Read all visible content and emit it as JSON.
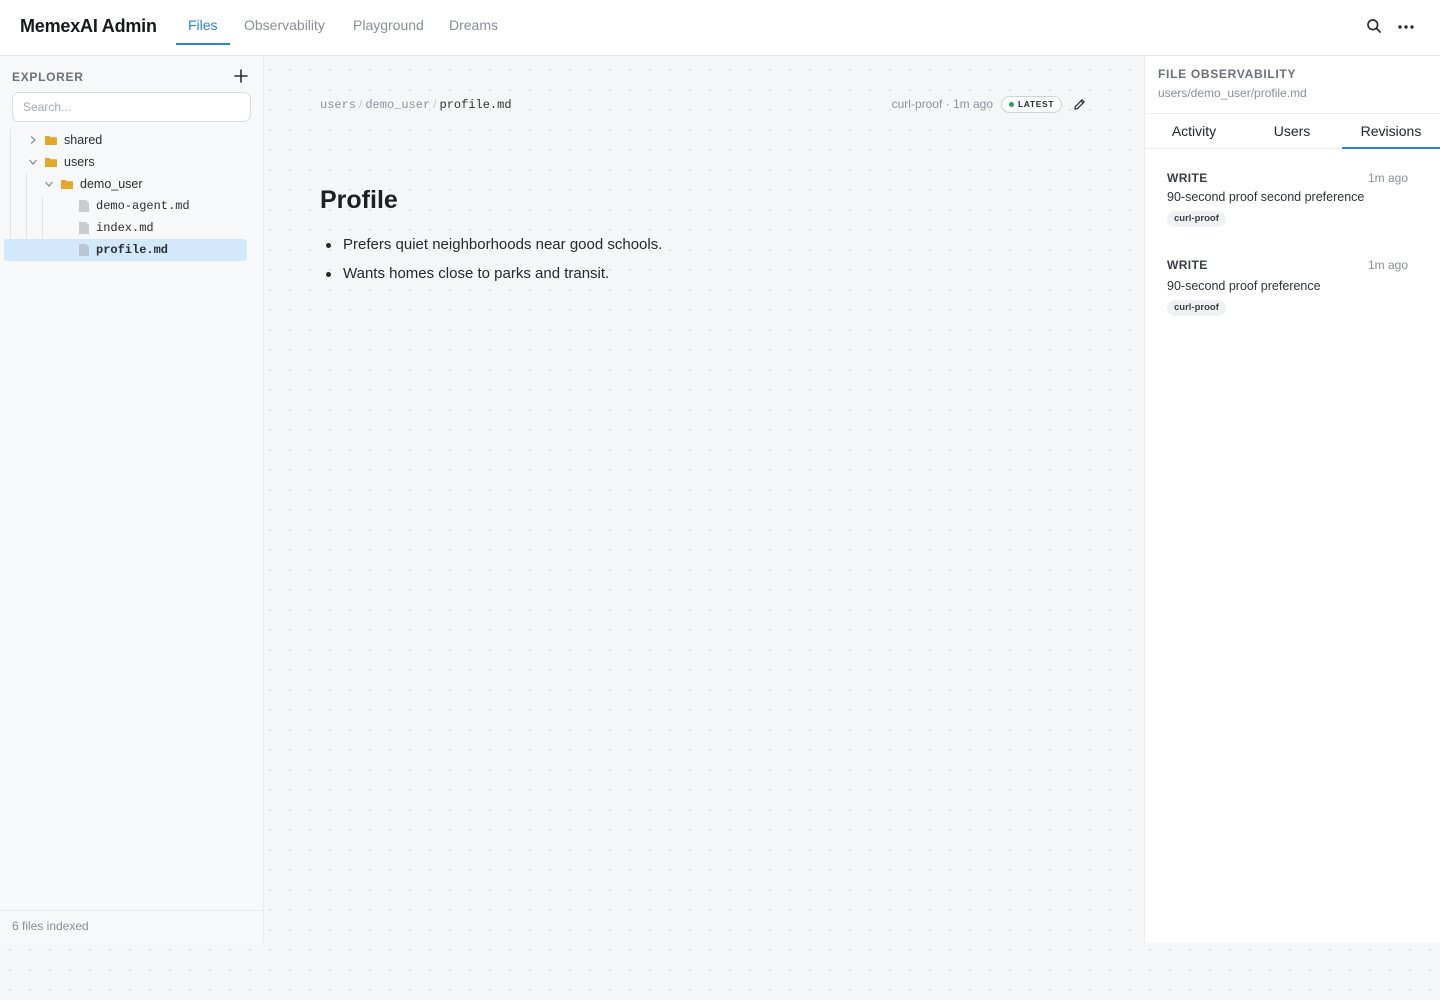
{
  "header": {
    "app_title": "MemexAI Admin",
    "tabs": [
      {
        "label": "Files",
        "active": true
      },
      {
        "label": "Observability",
        "active": false
      },
      {
        "label": "Playground",
        "active": false
      },
      {
        "label": "Dreams",
        "active": false
      }
    ],
    "icons": [
      "search-icon",
      "more-horizontal-icon"
    ]
  },
  "explorer": {
    "title": "EXPLORER",
    "search_placeholder": "Search...",
    "tree": [
      {
        "label": "shared",
        "type": "folder",
        "expanded": false
      },
      {
        "label": "users",
        "type": "folder",
        "expanded": true
      },
      {
        "label": "demo_user",
        "type": "folder",
        "expanded": true
      },
      {
        "label": "demo-agent.md",
        "type": "file"
      },
      {
        "label": "index.md",
        "type": "file"
      },
      {
        "label": "profile.md",
        "type": "file",
        "selected": true
      }
    ],
    "footer": "6 files indexed"
  },
  "document": {
    "breadcrumb": [
      "users",
      "demo_user",
      "profile.md"
    ],
    "breadcrumb_separator": "/",
    "meta": "curl-proof · 1m ago",
    "badge": "LATEST",
    "title": "Profile",
    "bullets": [
      "Prefers quiet neighborhoods near good schools.",
      "Wants homes close to parks and transit."
    ]
  },
  "observability": {
    "title": "FILE OBSERVABILITY",
    "path": "users/demo_user/profile.md",
    "tabs": [
      {
        "label": "Activity",
        "active": false
      },
      {
        "label": "Users",
        "active": false
      },
      {
        "label": "Revisions",
        "active": true
      }
    ],
    "revisions": [
      {
        "op": "WRITE",
        "time": "1m ago",
        "message": "90-second proof second preference",
        "tag": "curl-proof"
      },
      {
        "op": "WRITE",
        "time": "1m ago",
        "message": "90-second proof preference",
        "tag": "curl-proof"
      }
    ]
  },
  "colors": {
    "accent": "#2b84d2",
    "folder": "#e3a82b",
    "selection": "#d3e9fb",
    "latest_dot": "#26a55b"
  }
}
